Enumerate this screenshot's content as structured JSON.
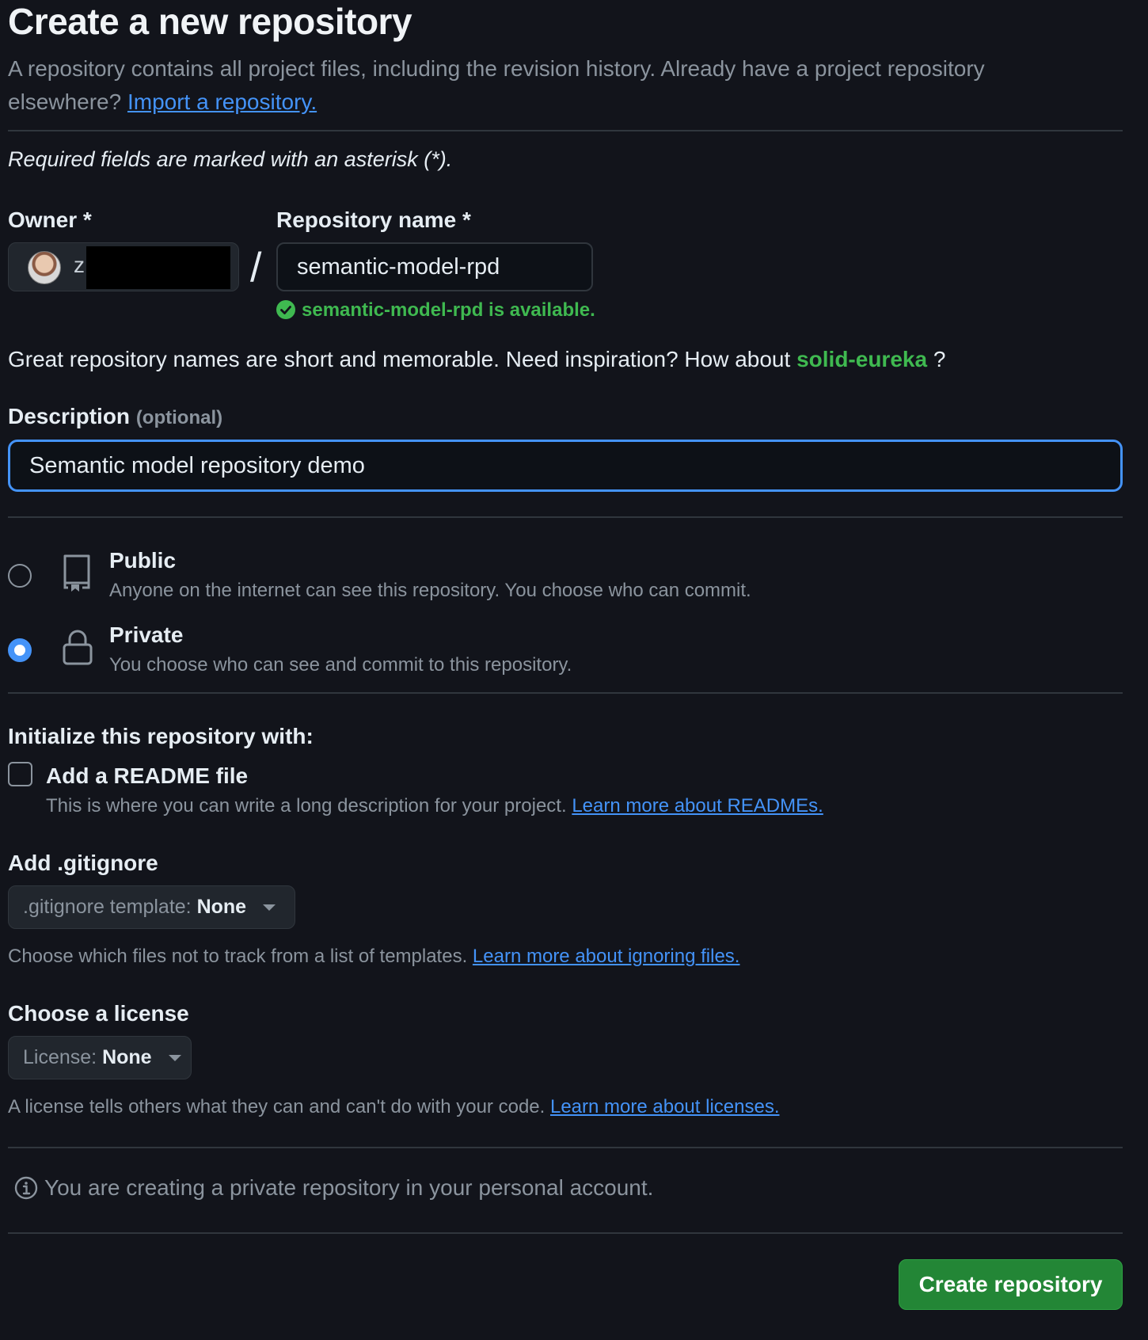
{
  "header": {
    "title": "Create a new repository",
    "intro_text": "A repository contains all project files, including the revision history. Already have a project repository elsewhere?",
    "import_link": "Import a repository."
  },
  "required_note": "Required fields are marked with an asterisk (*).",
  "owner": {
    "label": "Owner *",
    "initial": "z"
  },
  "separator": "/",
  "repo_name": {
    "label": "Repository name *",
    "value": "semantic-model-rpd",
    "availability": "semantic-model-rpd is available."
  },
  "inspiration": {
    "text": "Great repository names are short and memorable. Need inspiration? How about",
    "suggestion": "solid-eureka",
    "suffix": "?"
  },
  "description": {
    "label": "Description",
    "optional": "(optional)",
    "value": "Semantic model repository demo"
  },
  "visibility": {
    "selected": "private",
    "public": {
      "title": "Public",
      "desc": "Anyone on the internet can see this repository. You choose who can commit."
    },
    "private": {
      "title": "Private",
      "desc": "You choose who can see and commit to this repository."
    }
  },
  "initialize": {
    "heading": "Initialize this repository with:",
    "readme": {
      "label": "Add a README file",
      "checked": false,
      "desc": "This is where you can write a long description for your project.",
      "link": "Learn more about READMEs."
    }
  },
  "gitignore": {
    "heading": "Add .gitignore",
    "select_prefix": ".gitignore template:",
    "select_value": "None",
    "desc": "Choose which files not to track from a list of templates.",
    "link": "Learn more about ignoring files."
  },
  "license": {
    "heading": "Choose a license",
    "select_prefix": "License:",
    "select_value": "None",
    "desc": "A license tells others what they can and can't do with your code.",
    "link": "Learn more about licenses."
  },
  "notice": "You are creating a private repository in your personal account.",
  "submit_label": "Create repository",
  "icons": {
    "available": "check-circle-icon",
    "public": "repo-icon",
    "private": "lock-icon",
    "notice": "info-icon",
    "dropdown": "caret-down-icon"
  },
  "colors": {
    "background": "#12141b",
    "accent": "#4493f8",
    "success": "#3fb950",
    "primary_button": "#238636"
  }
}
